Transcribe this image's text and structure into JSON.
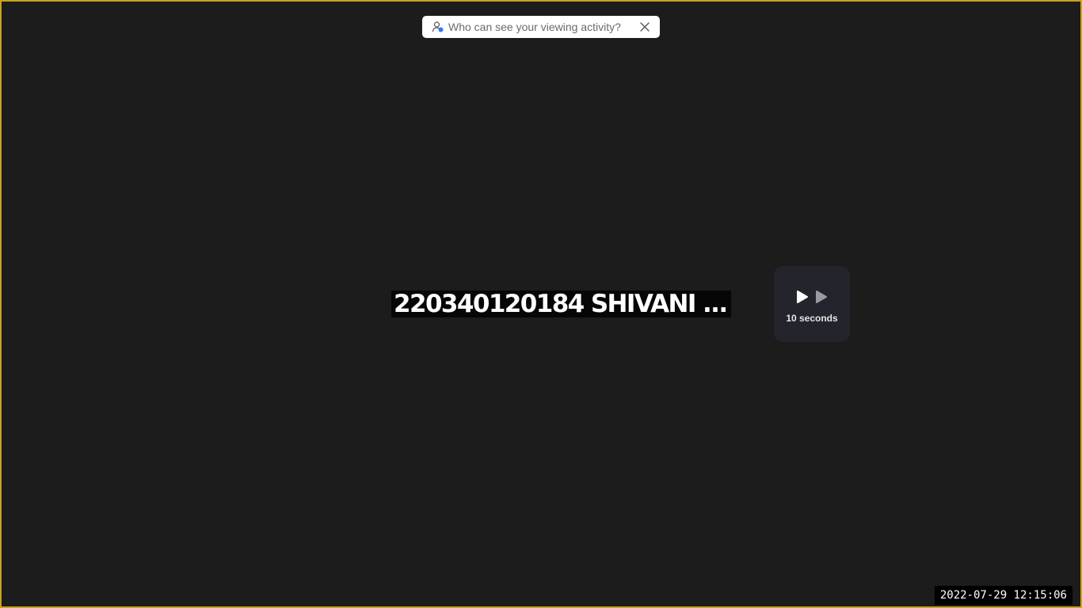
{
  "privacy_banner": {
    "text": "Who can see your viewing activity?",
    "icon": "person-privacy-icon",
    "close_icon": "close-icon"
  },
  "video": {
    "title": "220340120184 SHIVANI ..."
  },
  "skip_control": {
    "icons": [
      "play-icon",
      "play-icon-dimmed"
    ],
    "label": "10 seconds"
  },
  "overlay": {
    "timestamp": "2022-07-29 12:15:06"
  },
  "colors": {
    "background": "#1c1c1c",
    "window_border": "#c8a21a",
    "accent_blue": "#2d7cf6",
    "card": "#24242c"
  }
}
